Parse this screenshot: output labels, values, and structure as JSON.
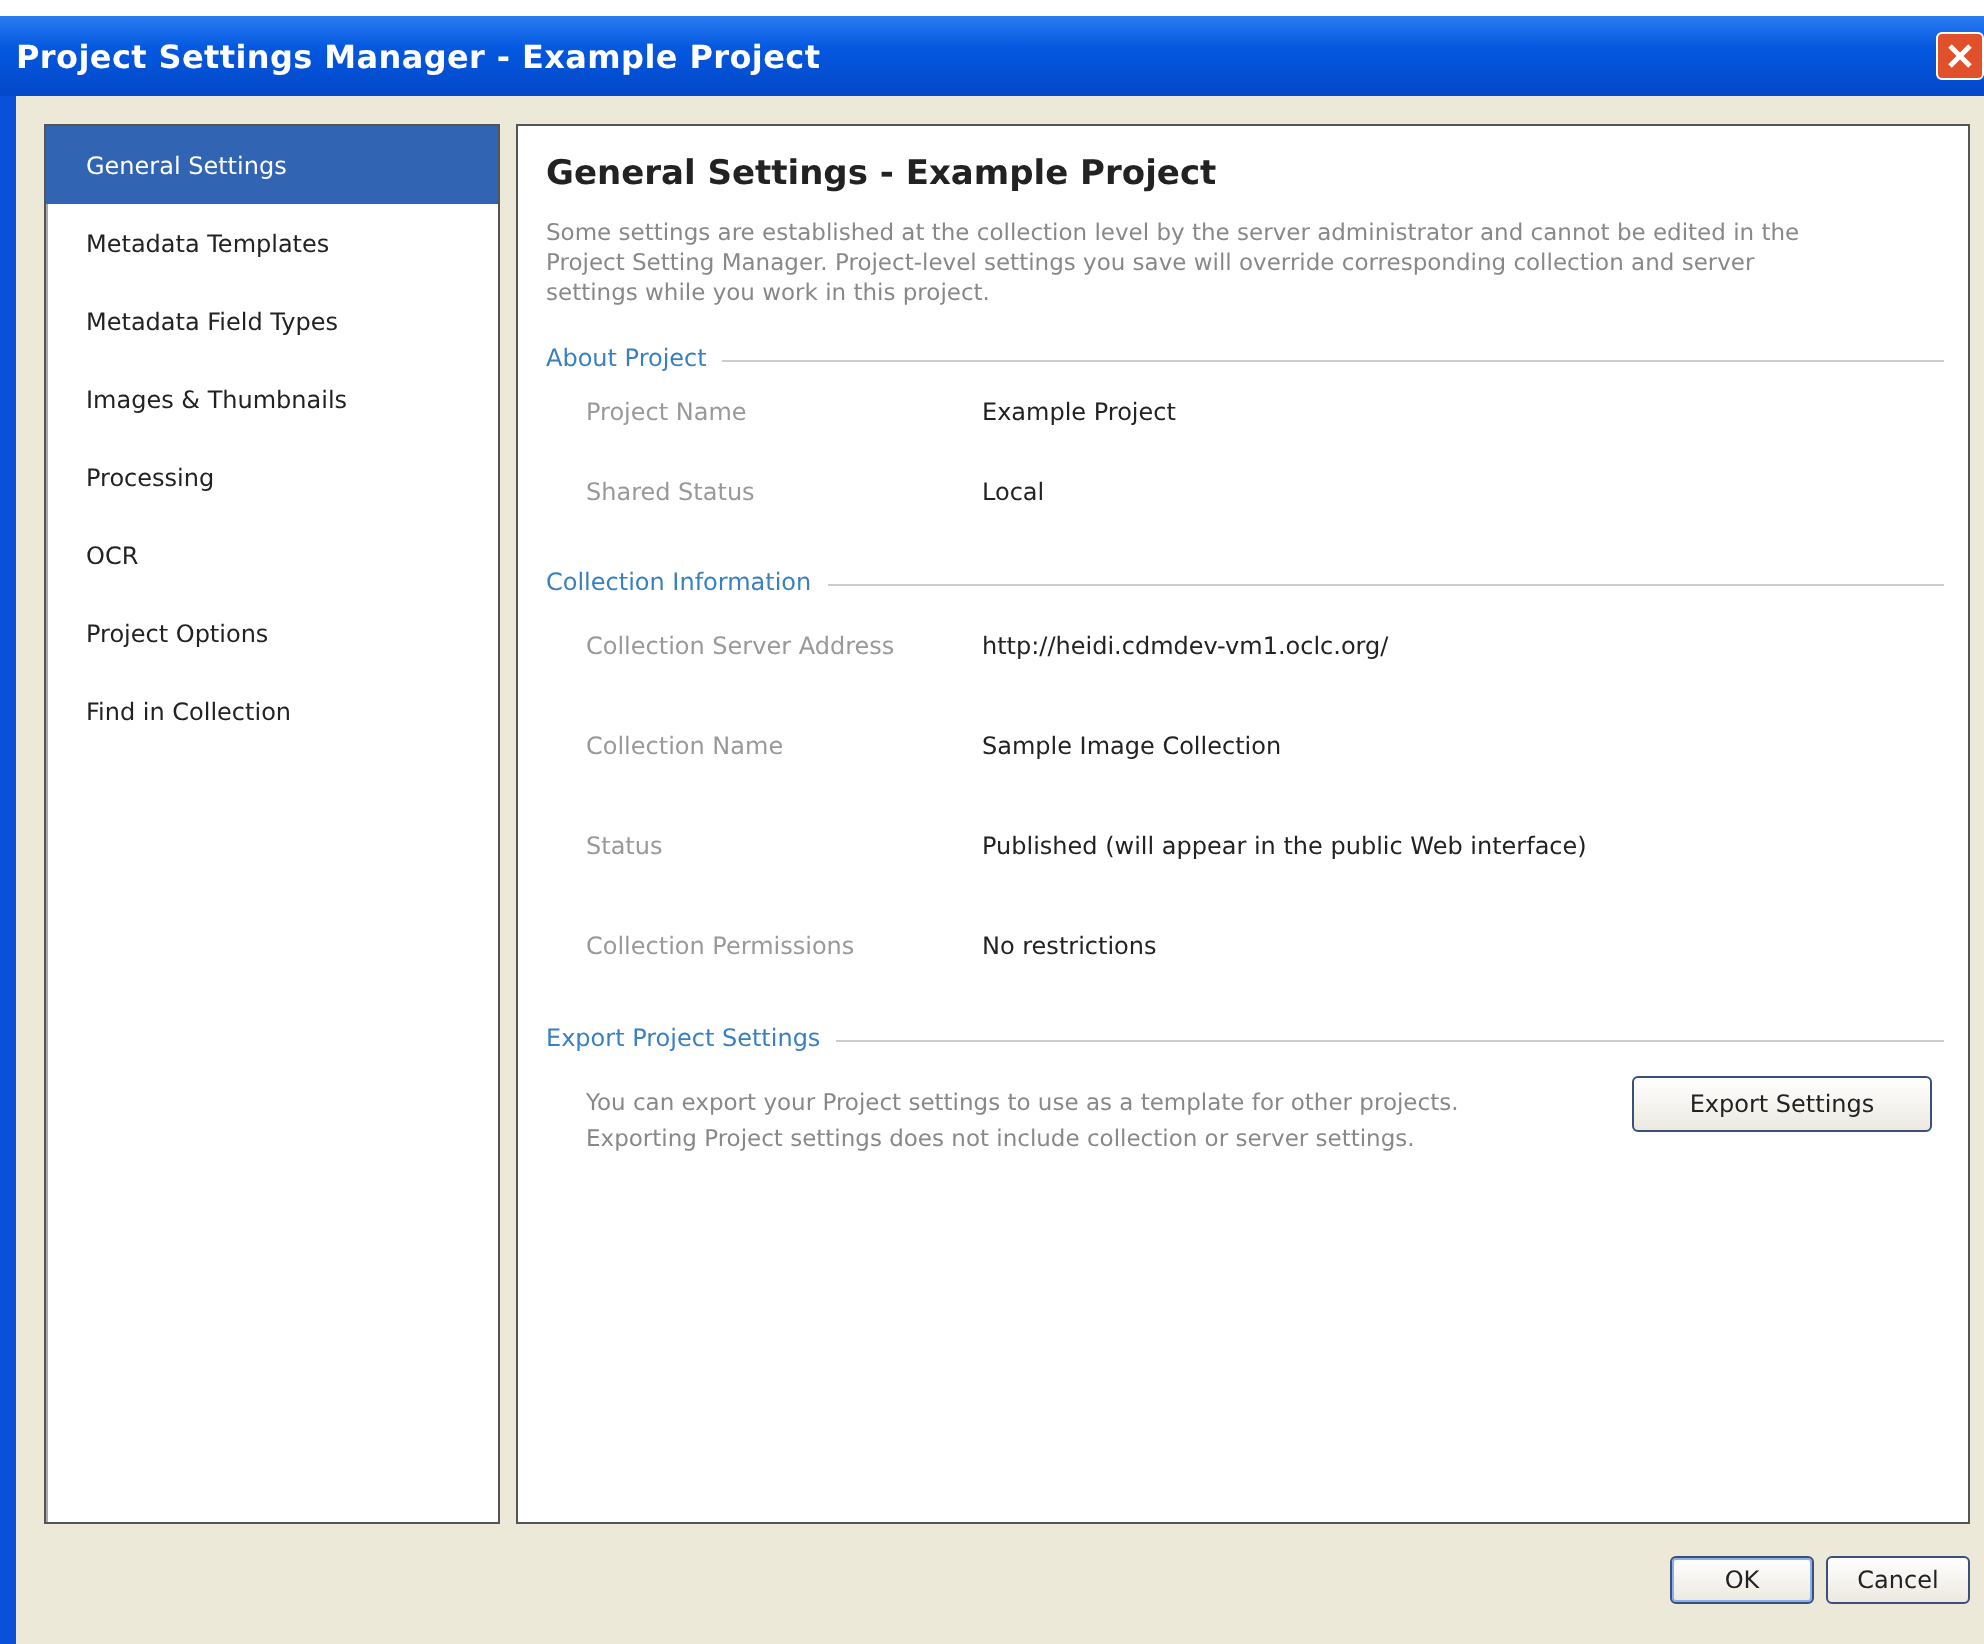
{
  "window": {
    "title": "Project Settings Manager - Example Project"
  },
  "sidebar": {
    "items": [
      {
        "label": "General Settings",
        "selected": true
      },
      {
        "label": "Metadata Templates",
        "selected": false
      },
      {
        "label": "Metadata Field Types",
        "selected": false
      },
      {
        "label": "Images & Thumbnails",
        "selected": false
      },
      {
        "label": "Processing",
        "selected": false
      },
      {
        "label": "OCR",
        "selected": false
      },
      {
        "label": "Project Options",
        "selected": false
      },
      {
        "label": "Find in Collection",
        "selected": false
      }
    ]
  },
  "content": {
    "heading": "General Settings - Example Project",
    "intro": "Some settings are established at the collection level by the server administrator and cannot be edited in the Project Setting Manager. Project-level settings you save will override corresponding collection and server settings while you work in this project.",
    "sections": [
      {
        "title": "About Project",
        "fields": [
          {
            "label": "Project Name",
            "value": "Example Project"
          },
          {
            "label": "Shared Status",
            "value": "Local"
          }
        ]
      },
      {
        "title": "Collection Information",
        "fields": [
          {
            "label": "Collection Server Address",
            "value": "http://heidi.cdmdev-vm1.oclc.org/"
          },
          {
            "label": "Collection Name",
            "value": "Sample Image Collection"
          },
          {
            "label": "Status",
            "value": "Published (will appear in the public Web interface)"
          },
          {
            "label": "Collection Permissions",
            "value": "No restrictions"
          }
        ]
      }
    ],
    "export": {
      "title": "Export Project Settings",
      "text": "You can export your Project settings to use as a template for other projects. Exporting Project settings does not include collection or server settings.",
      "button": "Export Settings"
    }
  },
  "buttons": [
    "OK",
    "Cancel"
  ]
}
